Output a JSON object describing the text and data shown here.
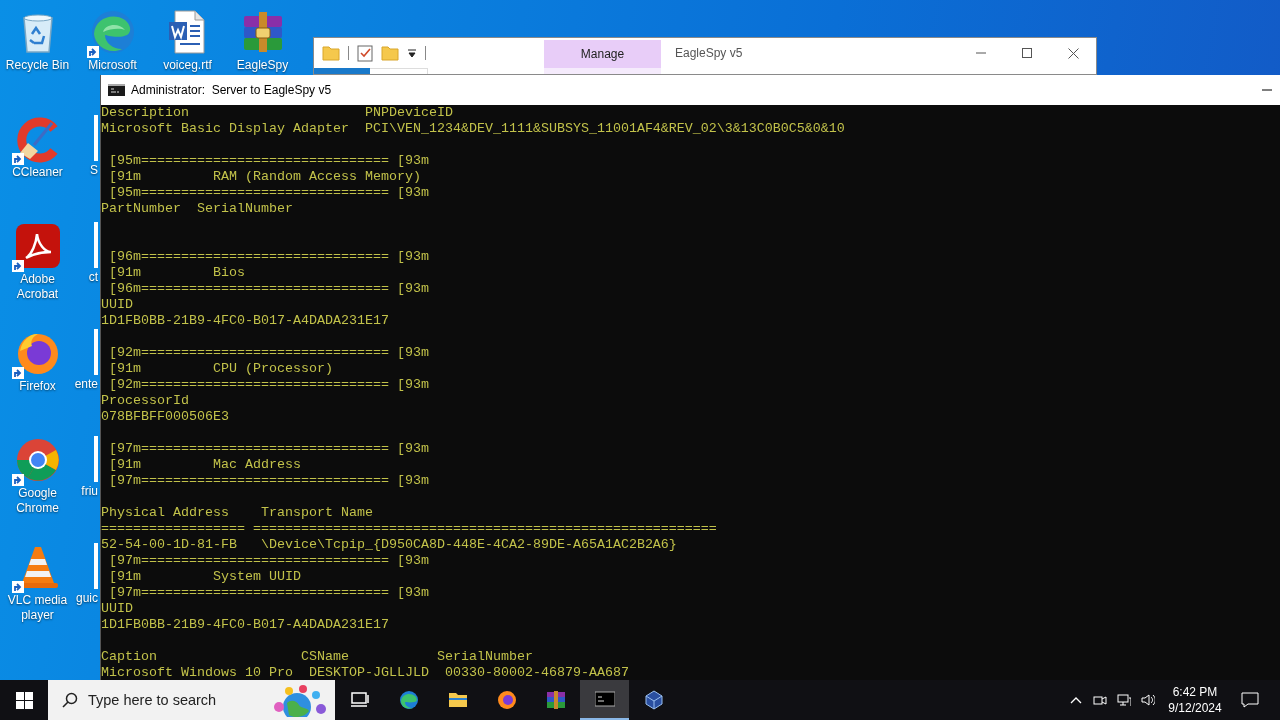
{
  "desktop_icons": [
    {
      "label": "Recycle Bin",
      "kind": "full",
      "shortcut": false
    },
    {
      "label": "Microsoft",
      "kind": "full",
      "shortcut": true
    },
    {
      "label": "voiceg.rtf",
      "kind": "full",
      "shortcut": false
    },
    {
      "label": "EagleSpy",
      "kind": "full",
      "shortcut": false
    },
    {
      "label": "CCleaner",
      "kind": "full",
      "shortcut": true
    },
    {
      "label": "S",
      "kind": "covered"
    },
    {
      "label": "Adobe Acrobat",
      "kind": "full",
      "shortcut": true
    },
    {
      "label": "ct",
      "kind": "covered"
    },
    {
      "label": "Firefox",
      "kind": "full",
      "shortcut": true
    },
    {
      "label": "ente",
      "kind": "covered"
    },
    {
      "label": "Google Chrome",
      "kind": "full",
      "shortcut": true
    },
    {
      "label": "friu",
      "kind": "covered"
    },
    {
      "label": "VLC media player",
      "kind": "full",
      "shortcut": true
    },
    {
      "label": "guic",
      "kind": "covered"
    }
  ],
  "explorer_window": {
    "ribbon_tab": "Manage",
    "title": "EagleSpy v5"
  },
  "console_window": {
    "title": "Administrator:  Server to EagleSpy v5",
    "lines": [
      {
        "kind": "text",
        "text": "Description                      PNPDeviceID"
      },
      {
        "kind": "text",
        "text": "Microsoft Basic Display Adapter  PCI\\VEN_1234&DEV_1111&SUBSYS_11001AF4&REV_02\\3&13C0B0C5&0&10"
      },
      {
        "kind": "blank"
      },
      {
        "kind": "text",
        "text": " [95m=============================== [93m"
      },
      {
        "kind": "text",
        "text": " [91m         RAM (Random Access Memory)"
      },
      {
        "kind": "text",
        "text": " [95m=============================== [93m"
      },
      {
        "kind": "text",
        "text": "PartNumber  SerialNumber"
      },
      {
        "kind": "blank"
      },
      {
        "kind": "blank"
      },
      {
        "kind": "text",
        "text": " [96m=============================== [93m"
      },
      {
        "kind": "text",
        "text": " [91m         Bios"
      },
      {
        "kind": "text",
        "text": " [96m=============================== [93m"
      },
      {
        "kind": "text",
        "text": "UUID"
      },
      {
        "kind": "text",
        "text": "1D1FB0BB-21B9-4FC0-B017-A4DADA231E17"
      },
      {
        "kind": "blank"
      },
      {
        "kind": "text",
        "text": " [92m=============================== [93m"
      },
      {
        "kind": "text",
        "text": " [91m         CPU (Processor)"
      },
      {
        "kind": "text",
        "text": " [92m=============================== [93m"
      },
      {
        "kind": "text",
        "text": "ProcessorId"
      },
      {
        "kind": "text",
        "text": "078BFBFF000506E3"
      },
      {
        "kind": "blank"
      },
      {
        "kind": "text",
        "text": " [97m=============================== [93m"
      },
      {
        "kind": "text",
        "text": " [91m         Mac Address"
      },
      {
        "kind": "text",
        "text": " [97m=============================== [93m"
      },
      {
        "kind": "blank"
      },
      {
        "kind": "text",
        "text": "Physical Address    Transport Name"
      },
      {
        "kind": "text",
        "text": "================== =========================================================="
      },
      {
        "kind": "text",
        "text": "52-54-00-1D-81-FB   \\Device\\Tcpip_{D950CA8D-448E-4CA2-89DE-A65A1AC2B2A6}"
      },
      {
        "kind": "text",
        "text": " [97m=============================== [93m"
      },
      {
        "kind": "text",
        "text": " [91m         System UUID"
      },
      {
        "kind": "text",
        "text": " [97m=============================== [93m"
      },
      {
        "kind": "text",
        "text": "UUID"
      },
      {
        "kind": "text",
        "text": "1D1FB0BB-21B9-4FC0-B017-A4DADA231E17"
      },
      {
        "kind": "blank"
      },
      {
        "kind": "text",
        "text": "Caption                  CSName           SerialNumber"
      },
      {
        "kind": "text",
        "text": "Microsoft Windows 10 Pro  DESKTOP-JGLLJLD  00330-80002-46879-AA687"
      }
    ]
  },
  "taskbar": {
    "search": {
      "placeholder": "Type here to search"
    },
    "apps": [
      {
        "selected": false
      },
      {
        "selected": false
      },
      {
        "selected": false
      },
      {
        "selected": false
      },
      {
        "selected": false
      },
      {
        "selected": true
      },
      {
        "selected": false
      }
    ],
    "clock": {
      "time": "6:42 PM",
      "date": "9/12/2024"
    }
  }
}
